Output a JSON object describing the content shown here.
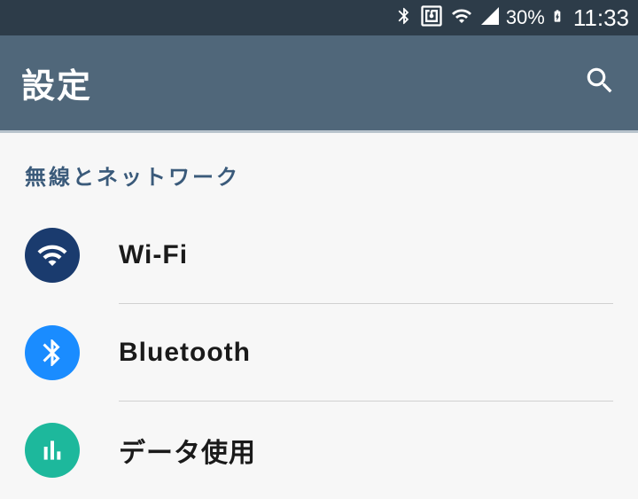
{
  "status_bar": {
    "battery_percent": "30%",
    "time": "11:33"
  },
  "app_bar": {
    "title": "設定"
  },
  "section": {
    "header": "無線とネットワーク",
    "items": [
      {
        "label": "Wi-Fi"
      },
      {
        "label": "Bluetooth"
      },
      {
        "label": "データ使用"
      }
    ]
  }
}
